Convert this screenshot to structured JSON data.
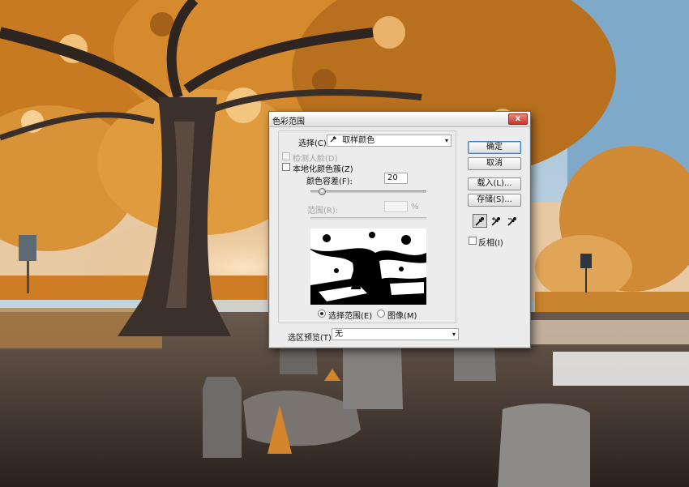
{
  "dialog": {
    "title": "色彩范围",
    "close_label": "x",
    "select_label": "选择(C):",
    "select_value": "取样颜色",
    "detect_faces_label": "检测人脸(D)",
    "localized_clusters_label": "本地化颜色簇(Z)",
    "fuzziness_label": "颜色容差(F):",
    "fuzziness_value": "20",
    "fuzziness_fraction": 0.1,
    "range_label": "范围(R):",
    "range_value": "",
    "range_unit": "%",
    "radio_selection_label": "选择范围(E)",
    "radio_image_label": "图像(M)",
    "preview_label": "选区预览(T):",
    "preview_value": "无",
    "buttons": {
      "ok": "确定",
      "cancel": "取消",
      "load": "载入(L)...",
      "save": "存储(S)..."
    },
    "invert_label": "反相(I)",
    "icons": {
      "dropdown": "▾",
      "sample_eyedropper": "eyedropper-icon",
      "add_eyedropper": "eyedropper-plus-icon",
      "subtract_eyedropper": "eyedropper-minus-icon"
    }
  },
  "colors": {
    "accent": "#3d7fc7",
    "close": "#c6372a",
    "foliage": "#d98a2b"
  }
}
